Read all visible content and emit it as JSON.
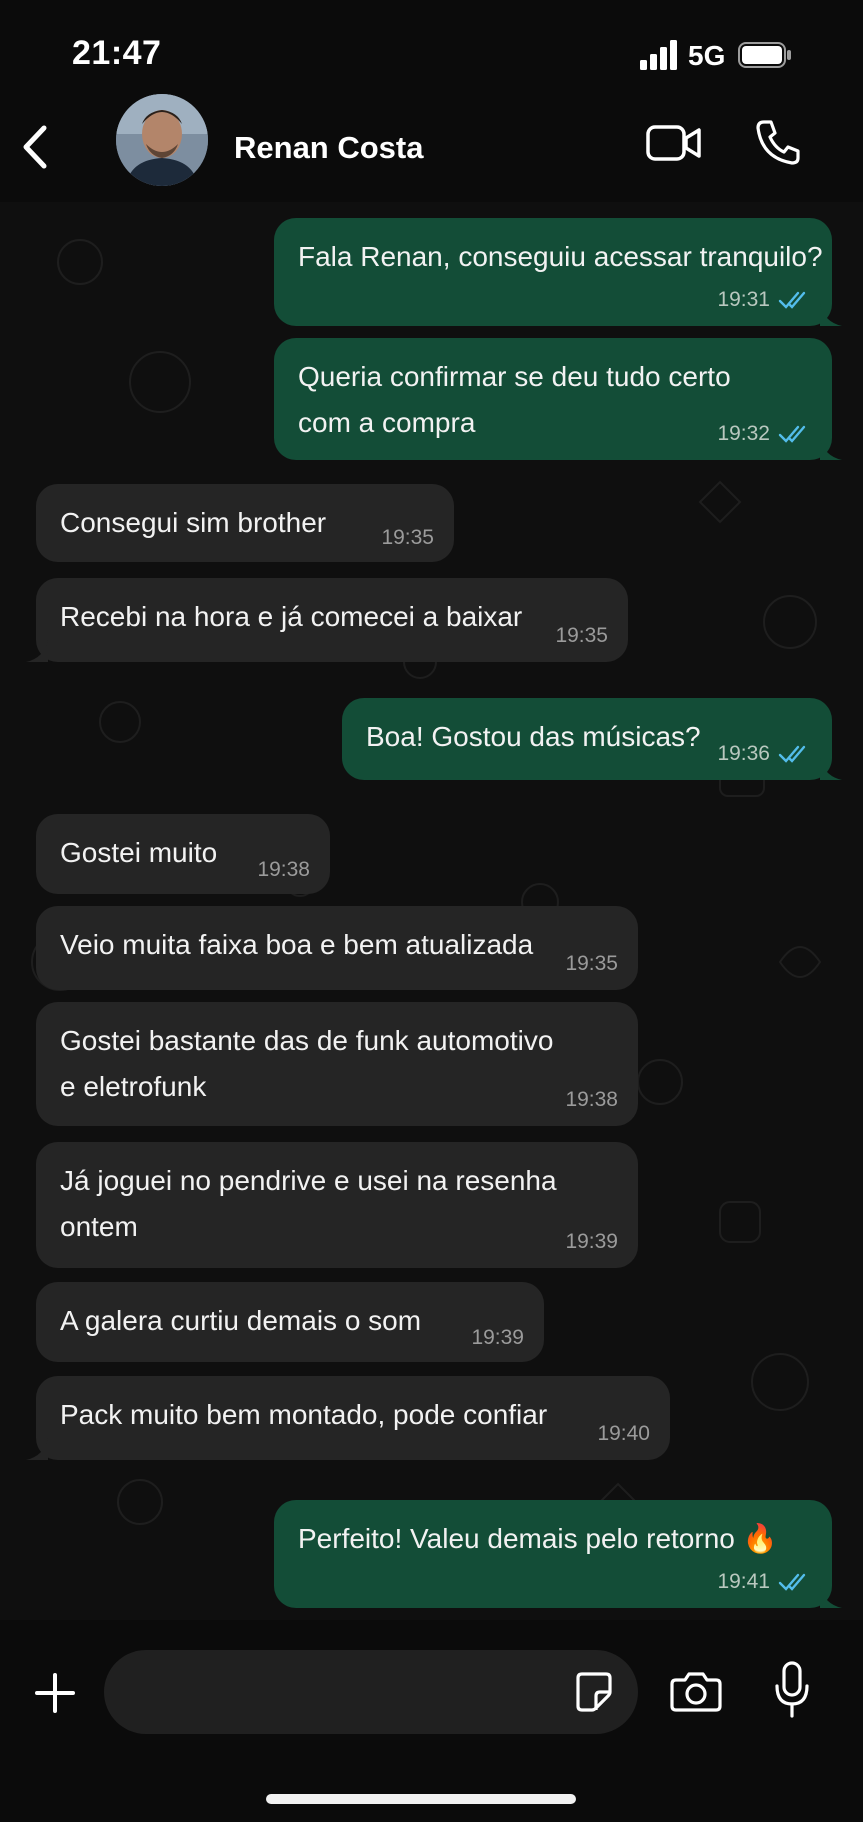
{
  "status_bar": {
    "time": "21:47",
    "network": "5G",
    "signal_icon": "signal-bars-icon",
    "battery_icon": "battery-icon"
  },
  "header": {
    "contact_name": "Renan Costa",
    "back_icon": "chevron-left-icon",
    "video_icon": "video-call-icon",
    "call_icon": "phone-icon"
  },
  "messages": [
    {
      "direction": "out",
      "text": "Fala Renan, conseguiu acessar tranquilo?",
      "time": "19:31",
      "status": "read"
    },
    {
      "direction": "out",
      "text": "Queria confirmar se deu tudo certo\ncom a compra",
      "time": "19:32",
      "status": "read"
    },
    {
      "direction": "in",
      "text": "Consegui sim brother",
      "time": "19:35"
    },
    {
      "direction": "in",
      "text": "Recebi na hora e já comecei a baixar",
      "time": "19:35"
    },
    {
      "direction": "out",
      "text": "Boa! Gostou das músicas?",
      "time": "19:36",
      "status": "read"
    },
    {
      "direction": "in",
      "text": "Gostei muito",
      "time": "19:38"
    },
    {
      "direction": "in",
      "text": "Veio muita faixa boa e bem atualizada",
      "time": "19:35"
    },
    {
      "direction": "in",
      "text": "Gostei bastante das de funk automotivo\ne eletrofunk",
      "time": "19:38"
    },
    {
      "direction": "in",
      "text": "Já joguei no pendrive e usei na resenha\nontem",
      "time": "19:39"
    },
    {
      "direction": "in",
      "text": "A galera curtiu demais o som",
      "time": "19:39"
    },
    {
      "direction": "in",
      "text": "Pack muito bem montado, pode confiar",
      "time": "19:40"
    },
    {
      "direction": "out",
      "text": "Perfeito! Valeu demais pelo retorno 🔥",
      "time": "19:41",
      "status": "read"
    }
  ],
  "composer": {
    "input_value": "",
    "plus_icon": "plus-icon",
    "sticker_icon": "sticker-icon",
    "camera_icon": "camera-icon",
    "mic_icon": "microphone-icon"
  },
  "colors": {
    "outgoing_bubble": "#134d37",
    "incoming_bubble": "#252525",
    "read_ticks": "#53bdeb",
    "background": "#0b0b0b"
  }
}
